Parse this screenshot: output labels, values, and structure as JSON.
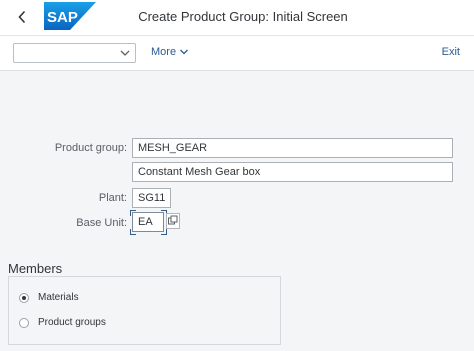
{
  "header": {
    "logo_text": "SAP",
    "title": "Create Product Group: Initial Screen"
  },
  "toolbar": {
    "dropdown_value": "",
    "more_label": "More",
    "exit_label": "Exit"
  },
  "form": {
    "product_group": {
      "label": "Product group:",
      "value": "MESH_GEAR",
      "description": "Constant Mesh Gear box"
    },
    "plant": {
      "label": "Plant:",
      "value": "SG11"
    },
    "base_unit": {
      "label": "Base Unit:",
      "value": "EA"
    }
  },
  "members": {
    "title": "Members",
    "options": [
      {
        "label": "Materials",
        "selected": true
      },
      {
        "label": "Product groups",
        "selected": false
      }
    ]
  },
  "colors": {
    "brand": "#1a7fd6",
    "link": "#2c5a90",
    "background": "#f3f5f7"
  }
}
